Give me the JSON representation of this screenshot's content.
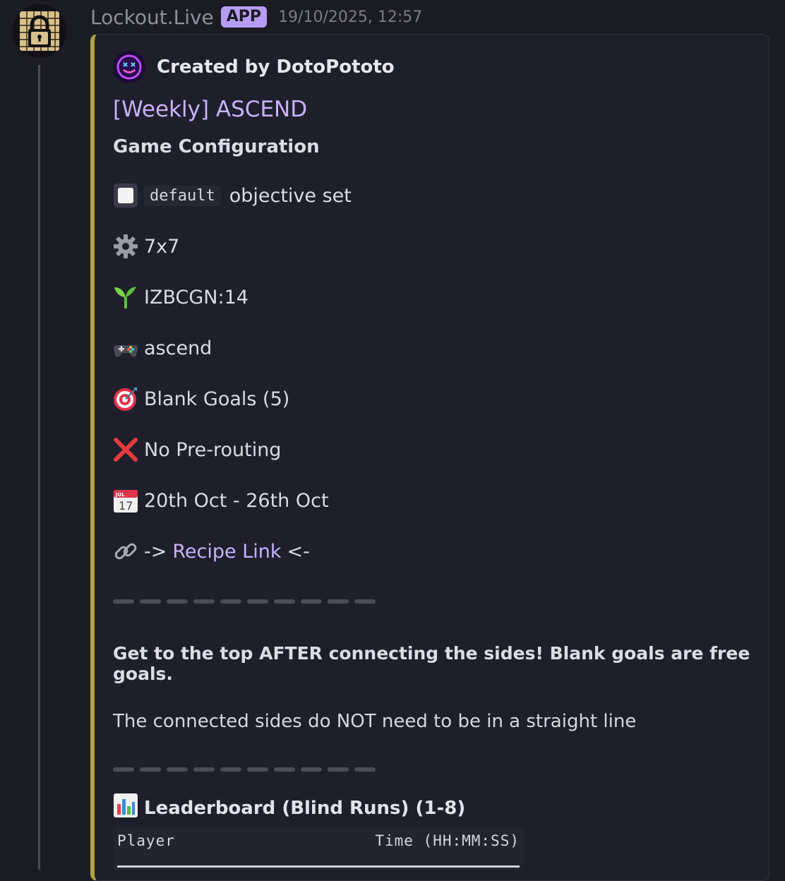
{
  "header": {
    "app_name": "Lockout.Live",
    "badge": "APP",
    "timestamp": "19/10/2025, 12:57"
  },
  "embed": {
    "accent_color": "#b4a040",
    "author": "Created by DotoPototo",
    "title": "[Weekly] ASCEND",
    "section_title": "Game Configuration",
    "config": {
      "objective_code": "default",
      "objective_text": "objective set",
      "size": "7x7",
      "seed": "IZBCGN:14",
      "mode": "ascend",
      "goals": "Blank Goals (5)",
      "routing": "No Pre-routing",
      "dates": "20th Oct - 26th Oct",
      "recipe_prefix": "->",
      "recipe_link": "Recipe Link",
      "recipe_suffix": "<-"
    },
    "description_bold": "Get to the top AFTER connecting the sides! Blank goals are free goals.",
    "description_plain": "The connected sides do NOT need to be in a straight line",
    "leaderboard": {
      "title": "Leaderboard (Blind Runs) (1-8)",
      "col_player": "Player",
      "col_time": "Time (HH:MM:SS)"
    }
  }
}
